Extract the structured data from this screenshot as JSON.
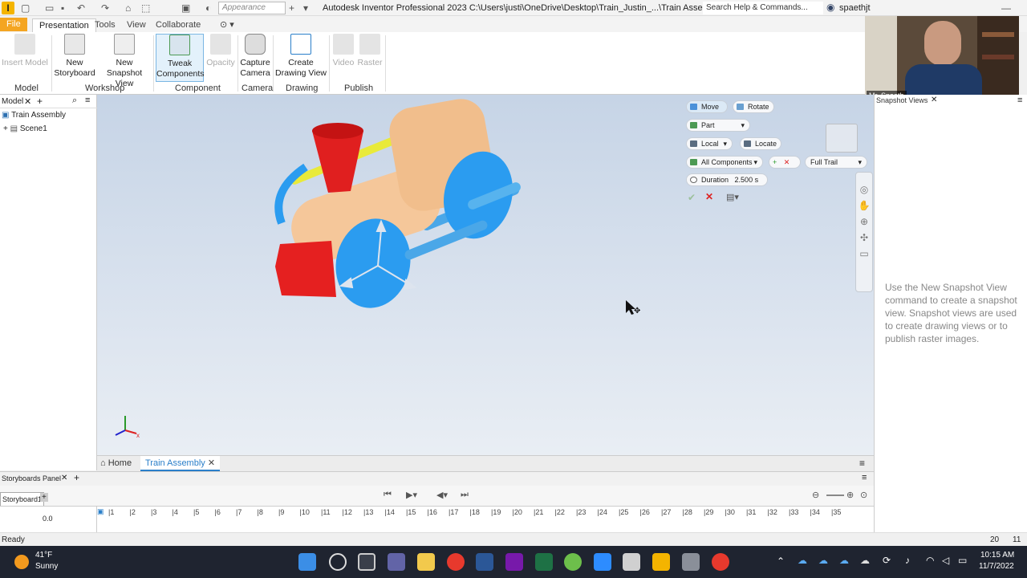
{
  "title_bar": {
    "appearance_placeholder": "Appearance",
    "window_title": "Autodesk Inventor Professional 2023   C:\\Users\\justi\\OneDrive\\Desktop\\Train_Justin_...\\Train Assembly",
    "search_label": "Search Help & Commands...",
    "user": "spaethjt",
    "app_letter": "I"
  },
  "tabs": [
    "File",
    "Presentation",
    "Tools",
    "View",
    "Collaborate"
  ],
  "ribbon": {
    "buttons": [
      {
        "label1": "Insert Model",
        "label2": "",
        "enabled": false
      },
      {
        "label1": "New",
        "label2": "Storyboard",
        "enabled": true
      },
      {
        "label1": "New",
        "label2": "Snapshot View",
        "enabled": true
      },
      {
        "label1": "Tweak",
        "label2": "Components",
        "enabled": true
      },
      {
        "label1": "Opacity",
        "label2": "",
        "enabled": false
      },
      {
        "label1": "Capture",
        "label2": "Camera",
        "enabled": true
      },
      {
        "label1": "Create",
        "label2": "Drawing View",
        "enabled": true
      },
      {
        "label1": "Video",
        "label2": "",
        "enabled": false
      },
      {
        "label1": "Raster",
        "label2": "",
        "enabled": false
      }
    ],
    "groups": [
      "Model",
      "Workshop",
      "Component",
      "Camera",
      "Drawing",
      "Publish"
    ]
  },
  "browser": {
    "tab": "Model",
    "items": [
      "Train Assembly",
      "Scene1"
    ]
  },
  "tweak": {
    "move": "Move",
    "rotate": "Rotate",
    "part": "Part",
    "local": "Local",
    "locate": "Locate",
    "all_components": "All Components",
    "full_trail": "Full Trail",
    "duration_label": "Duration",
    "duration_value": "2.500 s"
  },
  "snapshot": {
    "title": "Snapshot Views",
    "message": "Use the New Snapshot View command to create a snapshot view. Snapshot views are used to create drawing views or to publish raster images."
  },
  "webcam": {
    "name": "Mr. Spaeth"
  },
  "doc_tabs": [
    "Home",
    "Train Assembly"
  ],
  "storyboard": {
    "panel_title": "Storyboards Panel",
    "tab": "Storyboard1",
    "time": "0.0",
    "ticks": [
      "1",
      "2",
      "3",
      "4",
      "5",
      "6",
      "7",
      "8",
      "9",
      "10",
      "11",
      "12",
      "13",
      "14",
      "15",
      "16",
      "17",
      "18",
      "19",
      "20",
      "21",
      "22",
      "23",
      "24",
      "25",
      "26",
      "27",
      "28",
      "29",
      "30",
      "31",
      "32",
      "33",
      "34",
      "35"
    ]
  },
  "status": {
    "text": "Ready",
    "num1": "20",
    "num2": "11"
  },
  "taskbar": {
    "temp": "41°F",
    "weather": "Sunny",
    "time": "10:15 AM",
    "date": "11/7/2022"
  },
  "colors": {
    "accent": "#f4a522",
    "wheel": "#2b9cf0",
    "body": "#f5c79a",
    "red": "#e52020"
  }
}
